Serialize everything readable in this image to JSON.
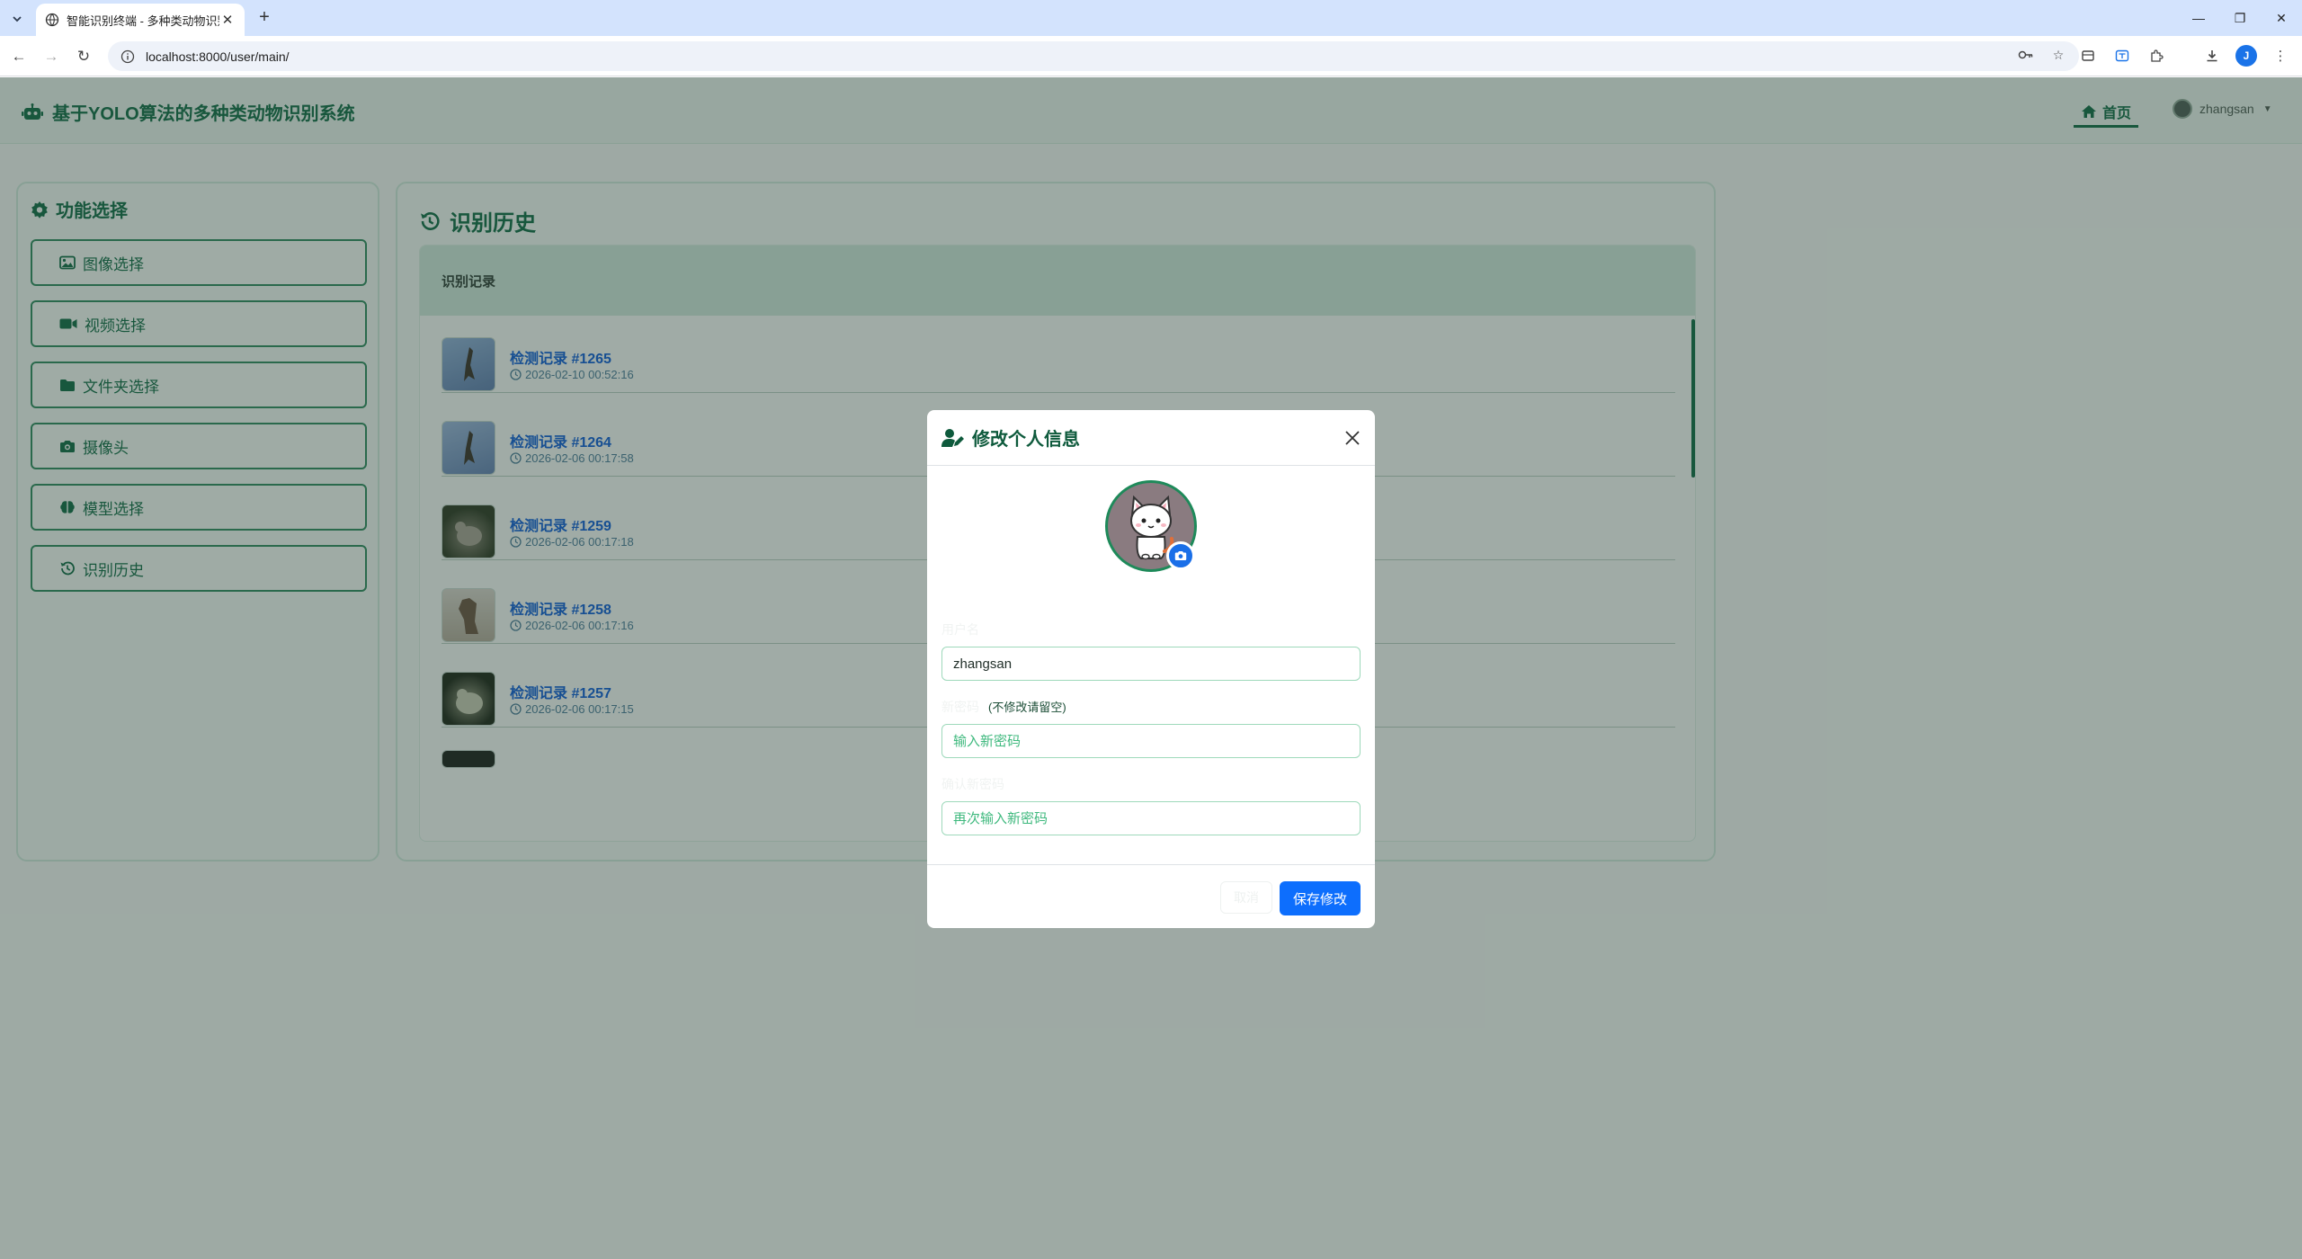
{
  "browser": {
    "tab_title": "智能识别终端 - 多种类动物识别",
    "url": "localhost:8000/user/main/",
    "icons": [
      "tab-search-icon",
      "globe-icon",
      "close-icon",
      "plus-icon",
      "minimize-icon",
      "restore-icon",
      "back-icon",
      "forward-icon",
      "reload-icon",
      "info-icon",
      "key-icon",
      "star-icon",
      "media-icon",
      "translate-icon",
      "extensions-icon",
      "download-icon",
      "profile-icon",
      "more-icon"
    ],
    "profile_initial": "J"
  },
  "header": {
    "title": "基于YOLO算法的多种类动物识别系统",
    "nav_home": "首页",
    "username": "zhangsan"
  },
  "sidebar": {
    "title": "功能选择",
    "items": [
      {
        "label": "图像选择",
        "icon": "image-icon"
      },
      {
        "label": "视频选择",
        "icon": "video-icon"
      },
      {
        "label": "文件夹选择",
        "icon": "folder-icon"
      },
      {
        "label": "摄像头",
        "icon": "camera-icon"
      },
      {
        "label": "模型选择",
        "icon": "brain-icon"
      },
      {
        "label": "识别历史",
        "icon": "history-icon"
      }
    ]
  },
  "history": {
    "title": "识别历史",
    "panel_header": "识别记录",
    "records": [
      {
        "title": "检测记录 #1265",
        "time": "2026-02-10 00:52:16",
        "thumb": "bird"
      },
      {
        "title": "检测记录 #1264",
        "time": "2026-02-06 00:17:58",
        "thumb": "bird"
      },
      {
        "title": "检测记录 #1259",
        "time": "2026-02-06 00:17:18",
        "thumb": "animal-dark"
      },
      {
        "title": "检测记录 #1258",
        "time": "2026-02-06 00:17:16",
        "thumb": "animal-light"
      },
      {
        "title": "检测记录 #1257",
        "time": "2026-02-06 00:17:15",
        "thumb": "animal-night"
      }
    ]
  },
  "modal": {
    "title": "修改个人信息",
    "username_label": "用户名",
    "username_value": "zhangsan",
    "password_label": "新密码",
    "password_hint": "(不修改请留空)",
    "password_placeholder": "输入新密码",
    "confirm_label": "确认新密码",
    "confirm_placeholder": "再次输入新密码",
    "cancel_label": "取消",
    "save_label": "保存修改"
  },
  "colors": {
    "brand": "#0e6b46",
    "primary_button": "#0d6efd",
    "link": "#0d5ed8",
    "overlay": "rgba(38,60,50,0.42)"
  }
}
